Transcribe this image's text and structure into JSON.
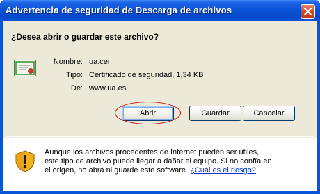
{
  "window": {
    "title": "Advertencia de seguridad de Descarga de archivos"
  },
  "question": "¿Desea abrir o guardar este archivo?",
  "file_info": {
    "name_label": "Nombre:",
    "name_value": "ua.cer",
    "type_label": "Tipo:",
    "type_value": "Certificado de seguridad, 1,34 KB",
    "from_label": "De:",
    "from_value": "www.ua.es"
  },
  "buttons": {
    "open": "Abrir",
    "save": "Guardar",
    "cancel": "Cancelar"
  },
  "warning": {
    "text": "Aunque los archivos procedentes de Internet pueden ser útiles, este tipo de archivo puede llegar a dañar el equipo. Si no confía en el origen, no abra ni guarde este software. ",
    "link": "¿Cuál es el riesgo?"
  },
  "icons": {
    "close": "close-icon",
    "certificate": "certificate-icon",
    "shield_warning": "shield-warning-icon"
  },
  "colors": {
    "titlebar": "#0a54d8",
    "close_button": "#d0451f",
    "dialog_background": "#ece9d8",
    "highlight": "#d01010",
    "link": "#0033cc"
  }
}
